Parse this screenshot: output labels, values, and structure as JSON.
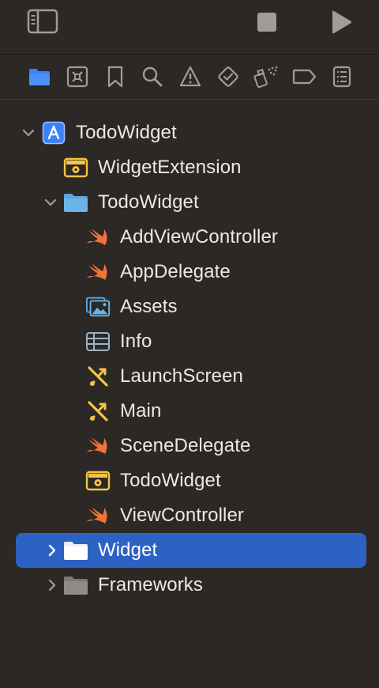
{
  "toolbar": {
    "icons": [
      "sidebar-toggle-icon",
      "stop-icon",
      "run-icon"
    ]
  },
  "navigator_tabs": [
    {
      "name": "project-navigator-icon",
      "active": true
    },
    {
      "name": "source-control-navigator-icon",
      "active": false
    },
    {
      "name": "bookmark-navigator-icon",
      "active": false
    },
    {
      "name": "find-navigator-icon",
      "active": false
    },
    {
      "name": "issue-navigator-icon",
      "active": false
    },
    {
      "name": "test-navigator-icon",
      "active": false
    },
    {
      "name": "debug-navigator-icon",
      "active": false
    },
    {
      "name": "breakpoint-navigator-icon",
      "active": false
    },
    {
      "name": "report-navigator-icon",
      "active": false
    }
  ],
  "colors": {
    "background": "#2b2826",
    "selection": "#2d62c5",
    "accent_blue": "#3a82f7",
    "swift_orange": "#f0733a",
    "folder_blue": "#6ab4e8",
    "target_yellow": "#f5c542",
    "text": "#ece9e5"
  },
  "tree": {
    "items": [
      {
        "label": "TodoWidget",
        "icon": "xcode-project-icon",
        "expanded": true
      },
      {
        "label": "WidgetExtension",
        "icon": "app-extension-target-icon"
      },
      {
        "label": "TodoWidget",
        "icon": "folder-icon",
        "expanded": true
      },
      {
        "label": "AddViewController",
        "icon": "swift-file-icon"
      },
      {
        "label": "AppDelegate",
        "icon": "swift-file-icon"
      },
      {
        "label": "Assets",
        "icon": "asset-catalog-icon"
      },
      {
        "label": "Info",
        "icon": "plist-icon"
      },
      {
        "label": "LaunchScreen",
        "icon": "interface-builder-icon"
      },
      {
        "label": "Main",
        "icon": "interface-builder-icon"
      },
      {
        "label": "SceneDelegate",
        "icon": "swift-file-icon"
      },
      {
        "label": "TodoWidget",
        "icon": "app-extension-target-icon"
      },
      {
        "label": "ViewController",
        "icon": "swift-file-icon"
      },
      {
        "label": "Widget",
        "icon": "folder-icon",
        "expanded": false,
        "selected": true
      },
      {
        "label": "Frameworks",
        "icon": "folder-icon",
        "expanded": false
      }
    ]
  }
}
